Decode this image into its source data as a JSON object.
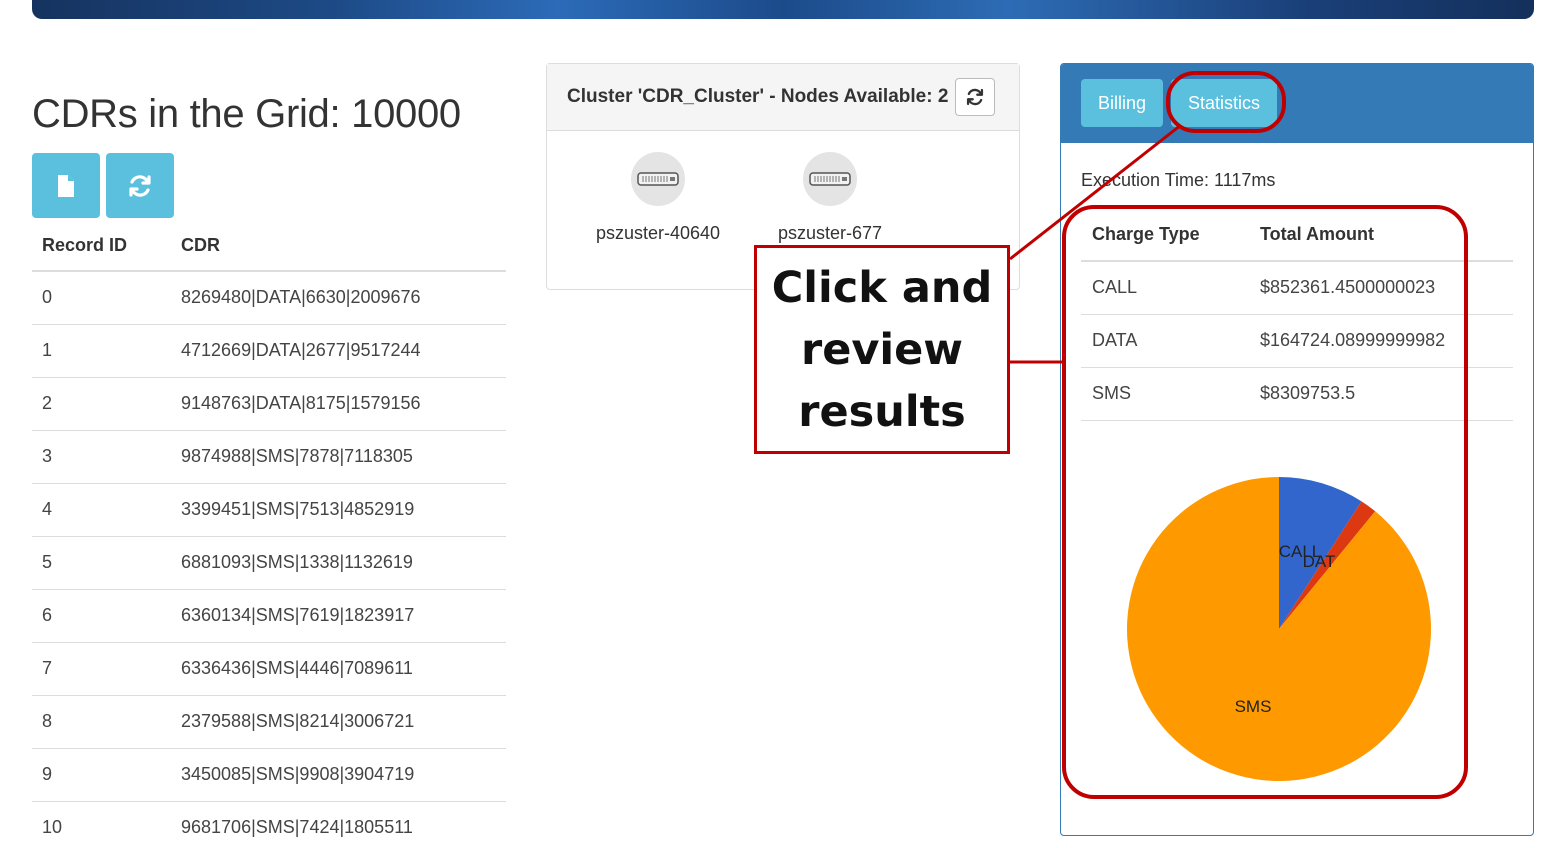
{
  "grid": {
    "title": "CDRs in the Grid: 10000",
    "columns": [
      "Record ID",
      "CDR"
    ],
    "rows": [
      [
        "0",
        "8269480|DATA|6630|2009676"
      ],
      [
        "1",
        "4712669|DATA|2677|9517244"
      ],
      [
        "2",
        "9148763|DATA|8175|1579156"
      ],
      [
        "3",
        "9874988|SMS|7878|7118305"
      ],
      [
        "4",
        "3399451|SMS|7513|4852919"
      ],
      [
        "5",
        "6881093|SMS|1338|1132619"
      ],
      [
        "6",
        "6360134|SMS|7619|1823917"
      ],
      [
        "7",
        "6336436|SMS|4446|7089611"
      ],
      [
        "8",
        "2379588|SMS|8214|3006721"
      ],
      [
        "9",
        "3450085|SMS|9908|3904719"
      ],
      [
        "10",
        "9681706|SMS|7424|1805511"
      ]
    ]
  },
  "cluster": {
    "title": "Cluster 'CDR_Cluster' - Nodes Available: 2",
    "nodes": [
      "pszuster-40640",
      "pszuster-677"
    ]
  },
  "stats": {
    "tabs": {
      "billing": "Billing",
      "statistics": "Statistics"
    },
    "execution_time": "Execution Time: 1117ms",
    "columns": [
      "Charge Type",
      "Total Amount"
    ],
    "rows": [
      [
        "CALL",
        "$852361.4500000023"
      ],
      [
        "DATA",
        "$164724.08999999982"
      ],
      [
        "SMS",
        "$8309753.5"
      ]
    ]
  },
  "chart_data": {
    "type": "pie",
    "categories": [
      "CALL",
      "DATA",
      "SMS"
    ],
    "values": [
      852361.45,
      164724.09,
      8309753.5
    ],
    "colors": [
      "#3366cc",
      "#dc3912",
      "#ff9900"
    ],
    "slice_labels": [
      "CALL",
      "DAT",
      "SMS"
    ]
  },
  "callout": {
    "text": "Click and review results",
    "color": "#c00000"
  },
  "icons": {
    "new": "file-icon",
    "refresh": "refresh-icon",
    "node": "server-icon"
  }
}
